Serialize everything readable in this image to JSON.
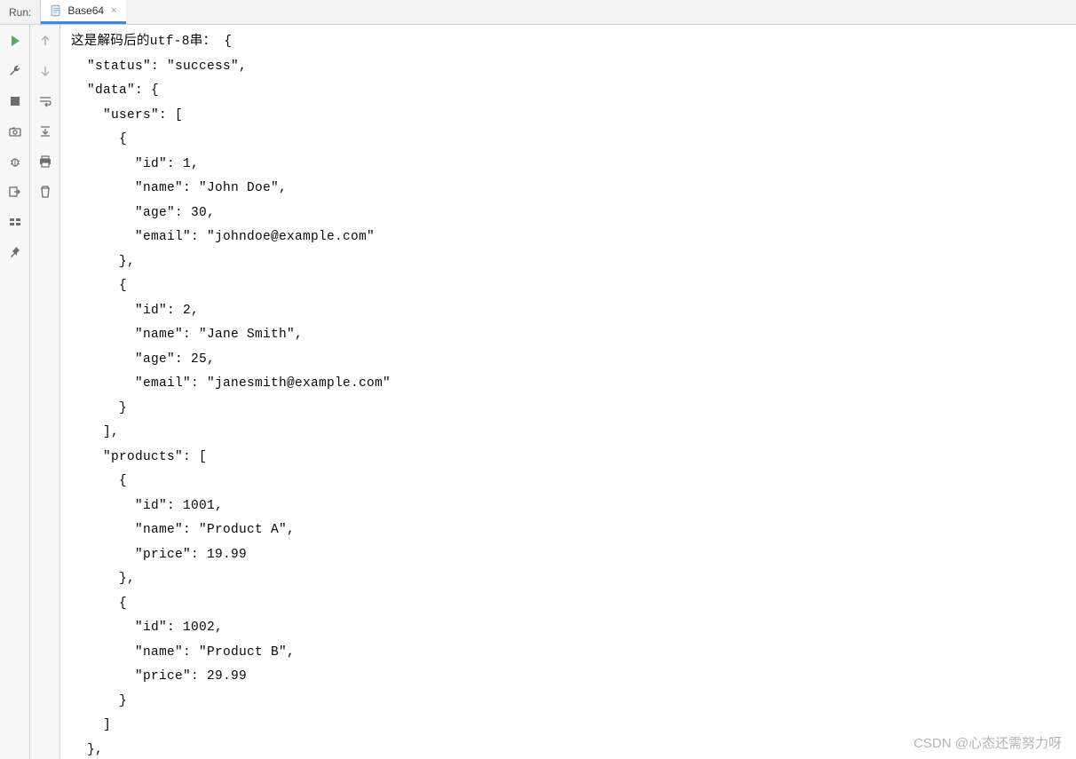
{
  "topbar": {
    "run_label": "Run:",
    "tab_label": "Base64",
    "tab_close": "×"
  },
  "console": {
    "lines": [
      "这是解码后的utf-8串： {",
      "  \"status\": \"success\",",
      "  \"data\": {",
      "    \"users\": [",
      "      {",
      "        \"id\": 1,",
      "        \"name\": \"John Doe\",",
      "        \"age\": 30,",
      "        \"email\": \"johndoe@example.com\"",
      "      },",
      "      {",
      "        \"id\": 2,",
      "        \"name\": \"Jane Smith\",",
      "        \"age\": 25,",
      "        \"email\": \"janesmith@example.com\"",
      "      }",
      "    ],",
      "    \"products\": [",
      "      {",
      "        \"id\": 1001,",
      "        \"name\": \"Product A\",",
      "        \"price\": 19.99",
      "      },",
      "      {",
      "        \"id\": 1002,",
      "        \"name\": \"Product B\",",
      "        \"price\": 29.99",
      "      }",
      "    ]",
      "  },"
    ]
  },
  "watermark": "CSDN @心态还需努力呀"
}
